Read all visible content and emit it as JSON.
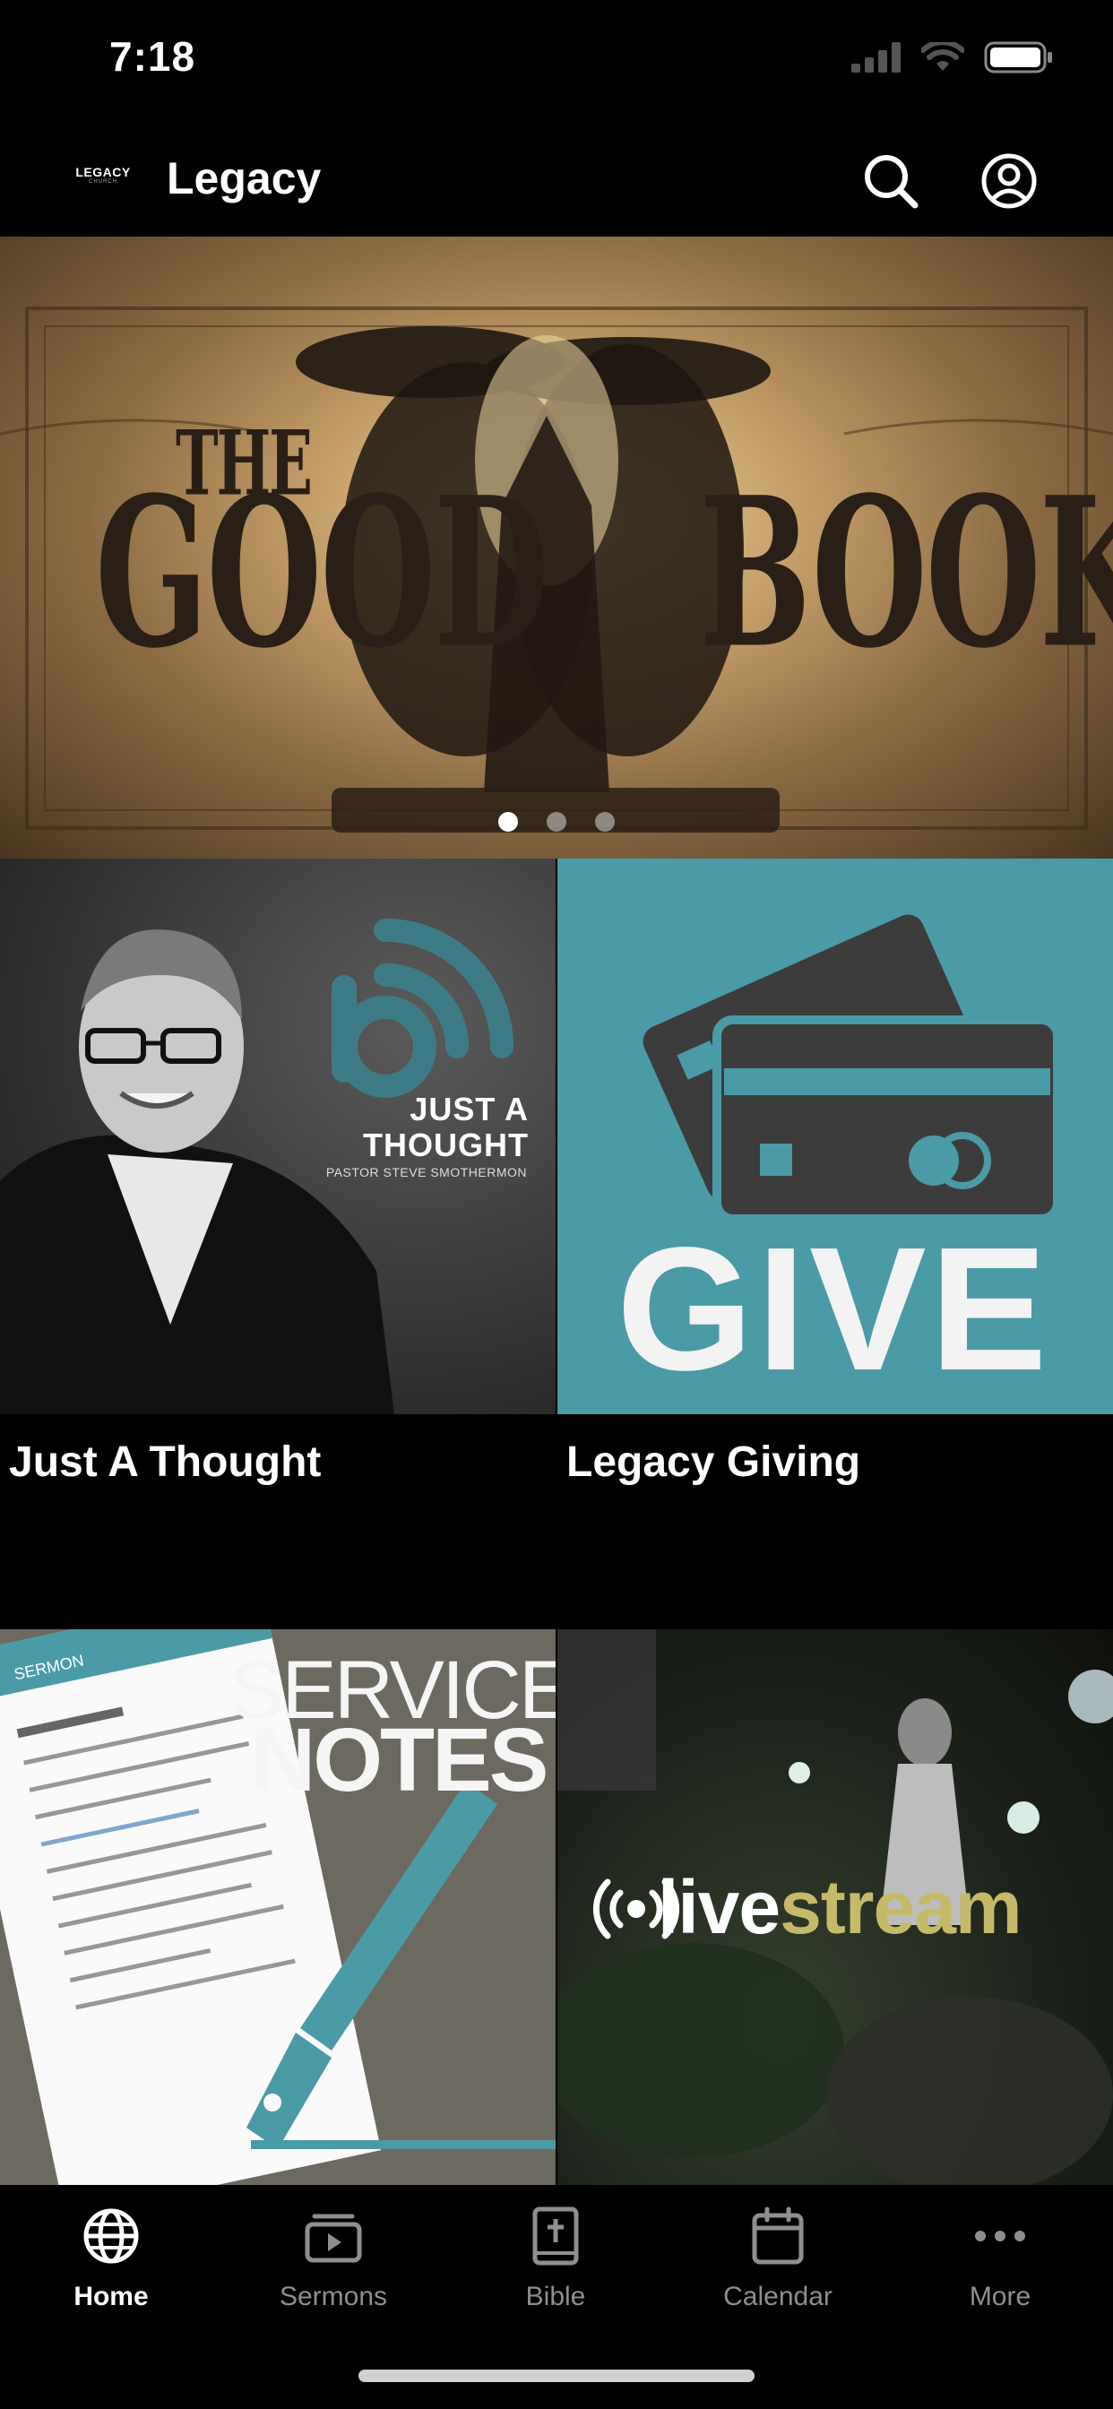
{
  "status_bar": {
    "time": "7:18"
  },
  "header": {
    "logo_text": "LEGACY",
    "logo_subtext": "CHURCH",
    "title": "Legacy"
  },
  "hero": {
    "art_words": [
      "THE",
      "GOOD",
      "BOOK"
    ],
    "carousel": {
      "count": 3,
      "active_index": 0
    }
  },
  "tiles": [
    {
      "caption": "Just A Thought",
      "art_title_line1": "JUST A",
      "art_title_line2": "THOUGHT",
      "art_subtitle": "PASTOR STEVE SMOTHERMON"
    },
    {
      "caption": "Legacy Giving",
      "art_word": "GIVE"
    },
    {
      "art_title_line1": "SERVICE",
      "art_title_line2": "NOTES",
      "phone_header": "SERMON"
    },
    {
      "art_word_part1": "live",
      "art_word_part2": "stream"
    }
  ],
  "tab_bar": {
    "items": [
      {
        "label": "Home",
        "icon": "globe-icon",
        "active": true
      },
      {
        "label": "Sermons",
        "icon": "sermons-play-icon",
        "active": false
      },
      {
        "label": "Bible",
        "icon": "bible-icon",
        "active": false
      },
      {
        "label": "Calendar",
        "icon": "calendar-icon",
        "active": false
      },
      {
        "label": "More",
        "icon": "more-dots-icon",
        "active": false
      }
    ]
  },
  "colors": {
    "background": "#000000",
    "give_teal": "#4b9aa8",
    "livestream_gold": "#c6ba6a",
    "tab_inactive": "#8e8e93",
    "tab_active": "#ffffff"
  }
}
